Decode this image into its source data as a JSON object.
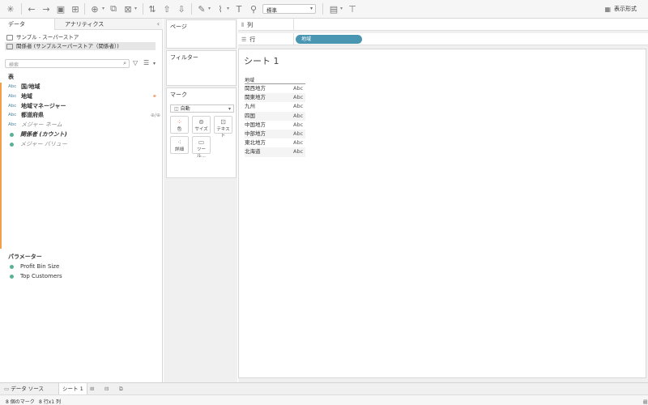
{
  "toolbar": {
    "format_select": "標準",
    "presentation_label": "表示形式"
  },
  "left_panel": {
    "tabs": [
      "データ",
      "アナリティクス"
    ],
    "collapse_icon": "‹",
    "datasources": [
      "サンプル - スーパーストア",
      "関係者 (サンプルスーパーストア（関係者）)"
    ],
    "search_placeholder": "検索",
    "table_section": "表",
    "fields": [
      {
        "type": "Abc",
        "name": "国/地域",
        "style": "bold"
      },
      {
        "type": "Abc",
        "name": "地域",
        "style": "bold"
      },
      {
        "type": "Abc",
        "name": "地域マネージャー",
        "style": "bold"
      },
      {
        "type": "Abc",
        "name": "都道府県",
        "style": "bold"
      },
      {
        "type": "Abc",
        "name": "メジャー ネーム",
        "style": "italic"
      }
    ],
    "measures": [
      {
        "name": "関係者 (カウント)",
        "style": "italic-dark"
      },
      {
        "name": "メジャー バリュー",
        "style": "italic"
      }
    ],
    "geo_marker": "⊕/⊕",
    "parameters_section": "パラメーター",
    "parameters": [
      "Profit Bin Size",
      "Top Customers"
    ]
  },
  "mid_panel": {
    "pages_title": "ページ",
    "filters_title": "フィルター",
    "marks_title": "マーク",
    "marks_type": "自動",
    "mark_buttons": [
      "色",
      "サイズ",
      "テキスト",
      "詳細",
      "ツール..."
    ]
  },
  "shelves": {
    "columns_label": "列",
    "rows_label": "行",
    "rows_pill": "地域"
  },
  "sheet": {
    "title": "シート 1",
    "table_header": "地域",
    "rows": [
      {
        "k": "関西地方",
        "v": "Abc"
      },
      {
        "k": "関東地方",
        "v": "Abc"
      },
      {
        "k": "九州",
        "v": "Abc"
      },
      {
        "k": "四国",
        "v": "Abc"
      },
      {
        "k": "中国地方",
        "v": "Abc"
      },
      {
        "k": "中部地方",
        "v": "Abc"
      },
      {
        "k": "東北地方",
        "v": "Abc"
      },
      {
        "k": "北海道",
        "v": "Abc"
      }
    ]
  },
  "bottom": {
    "datasource_tab": "データ ソース",
    "sheet_tab": "シート 1"
  },
  "status": {
    "marks": "8 個のマーク",
    "dims": "8 行x1 列"
  }
}
